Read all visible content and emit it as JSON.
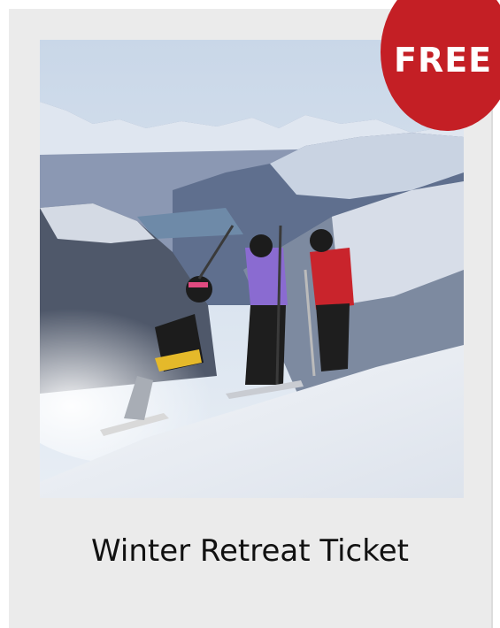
{
  "product": {
    "title": "Winter Retreat Ticket",
    "badge": "FREE",
    "image_icon": "ski-photo",
    "badge_color": "#c41f25"
  }
}
